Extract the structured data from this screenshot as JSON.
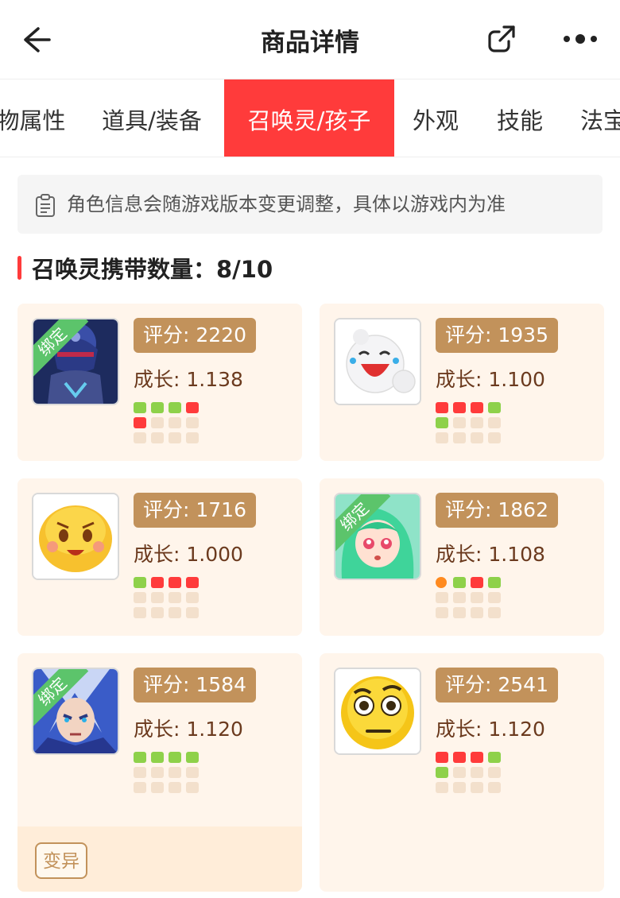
{
  "header": {
    "title": "商品详情"
  },
  "tabs": [
    {
      "label": "物属性",
      "active": false
    },
    {
      "label": "道具/装备",
      "active": false
    },
    {
      "label": "召唤灵/孩子",
      "active": true
    },
    {
      "label": "外观",
      "active": false
    },
    {
      "label": "技能",
      "active": false
    },
    {
      "label": "法宝",
      "active": false
    }
  ],
  "notice": {
    "text": "角色信息会随游戏版本变更调整，具体以游戏内为准"
  },
  "section": {
    "title": "召唤灵携带数量：8/10"
  },
  "colors": {
    "accent": "#ff3b3b",
    "score_badge": "#c2925b",
    "card_bg": "#fff5eb",
    "dot_green": "#8ed14a",
    "dot_red": "#ff3b3b",
    "dot_orange": "#ff8a1f",
    "dot_empty": "#f3e0cc"
  },
  "pets": [
    {
      "score": "评分: 2220",
      "growth": "成长: 1.138",
      "bound": true,
      "bound_label": "绑定",
      "avatar": "armored-knight-avatar",
      "dots": [
        "green",
        "green",
        "green",
        "red",
        "red",
        "empty",
        "empty",
        "empty",
        "empty",
        "empty",
        "empty",
        "empty"
      ]
    },
    {
      "score": "评分: 1935",
      "growth": "成长: 1.100",
      "bound": false,
      "avatar": "laughing-snowball-avatar",
      "dots": [
        "red",
        "red",
        "red",
        "green",
        "green",
        "empty",
        "empty",
        "empty",
        "empty",
        "empty",
        "empty",
        "empty"
      ]
    },
    {
      "score": "评分: 1716",
      "growth": "成长: 1.000",
      "bound": false,
      "avatar": "smiling-face-avatar",
      "dots": [
        "green",
        "red",
        "red",
        "red",
        "empty",
        "empty",
        "empty",
        "empty",
        "empty",
        "empty",
        "empty",
        "empty"
      ]
    },
    {
      "score": "评分: 1862",
      "growth": "成长: 1.108",
      "bound": true,
      "bound_label": "绑定",
      "avatar": "green-hair-girl-avatar",
      "dots": [
        "orange",
        "green",
        "red",
        "green",
        "empty",
        "empty",
        "empty",
        "empty",
        "empty",
        "empty",
        "empty",
        "empty"
      ]
    },
    {
      "score": "评分: 1584",
      "growth": "成长: 1.120",
      "bound": true,
      "bound_label": "绑定",
      "avatar": "silver-hair-warrior-avatar",
      "dots": [
        "green",
        "green",
        "green",
        "green",
        "empty",
        "empty",
        "empty",
        "empty",
        "empty",
        "empty",
        "empty",
        "empty"
      ],
      "variant_label": "变异"
    },
    {
      "score": "评分: 2541",
      "growth": "成长: 1.120",
      "bound": false,
      "avatar": "skeptical-face-avatar",
      "dots": [
        "red",
        "red",
        "red",
        "green",
        "green",
        "empty",
        "empty",
        "empty",
        "empty",
        "empty",
        "empty",
        "empty"
      ]
    }
  ]
}
